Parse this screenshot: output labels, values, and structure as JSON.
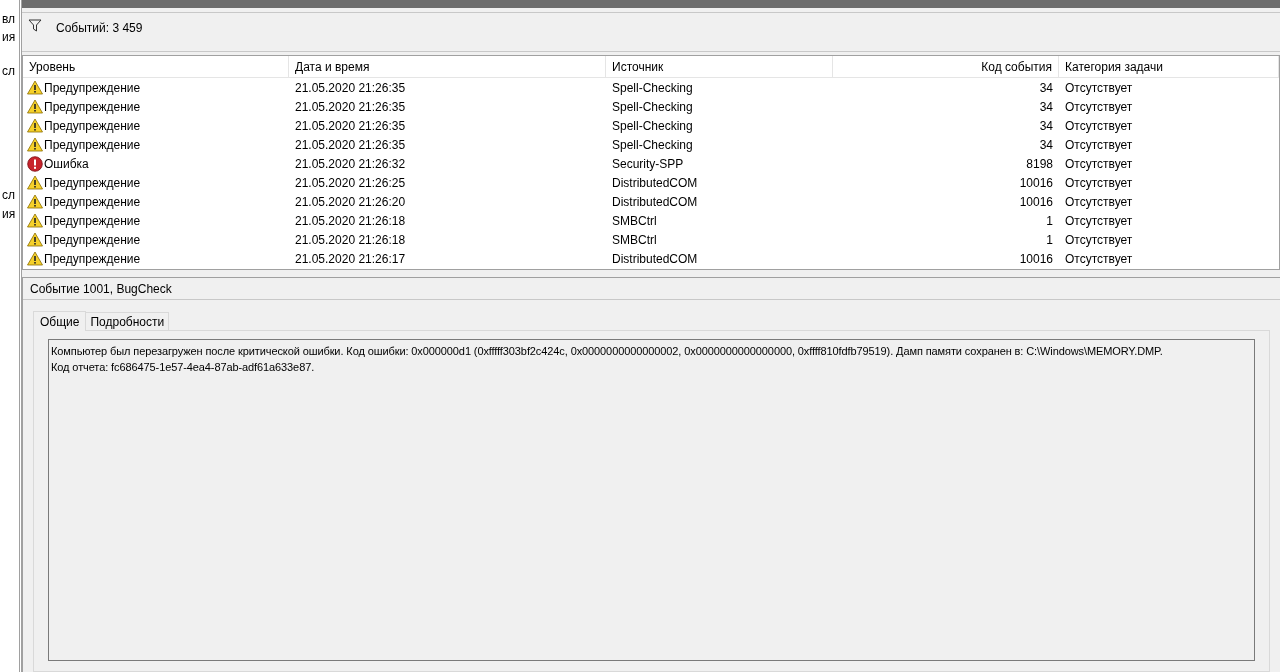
{
  "sidebar_fragments": [
    "вл",
    "ия",
    "сл",
    "сл",
    "ия"
  ],
  "toolbar": {
    "count_label": "Событий: 3 459"
  },
  "table": {
    "columns": [
      "Уровень",
      "Дата и время",
      "Источник",
      "Код события",
      "Категория задачи"
    ],
    "rows": [
      {
        "kind": "warning",
        "level": "Предупреждение",
        "date": "21.05.2020 21:26:35",
        "source": "Spell-Checking",
        "code": "34",
        "category": "Отсутствует"
      },
      {
        "kind": "warning",
        "level": "Предупреждение",
        "date": "21.05.2020 21:26:35",
        "source": "Spell-Checking",
        "code": "34",
        "category": "Отсутствует"
      },
      {
        "kind": "warning",
        "level": "Предупреждение",
        "date": "21.05.2020 21:26:35",
        "source": "Spell-Checking",
        "code": "34",
        "category": "Отсутствует"
      },
      {
        "kind": "warning",
        "level": "Предупреждение",
        "date": "21.05.2020 21:26:35",
        "source": "Spell-Checking",
        "code": "34",
        "category": "Отсутствует"
      },
      {
        "kind": "error",
        "level": "Ошибка",
        "date": "21.05.2020 21:26:32",
        "source": "Security-SPP",
        "code": "8198",
        "category": "Отсутствует"
      },
      {
        "kind": "warning",
        "level": "Предупреждение",
        "date": "21.05.2020 21:26:25",
        "source": "DistributedCOM",
        "code": "10016",
        "category": "Отсутствует"
      },
      {
        "kind": "warning",
        "level": "Предупреждение",
        "date": "21.05.2020 21:26:20",
        "source": "DistributedCOM",
        "code": "10016",
        "category": "Отсутствует"
      },
      {
        "kind": "warning",
        "level": "Предупреждение",
        "date": "21.05.2020 21:26:18",
        "source": "SMBCtrl",
        "code": "1",
        "category": "Отсутствует"
      },
      {
        "kind": "warning",
        "level": "Предупреждение",
        "date": "21.05.2020 21:26:18",
        "source": "SMBCtrl",
        "code": "1",
        "category": "Отсутствует"
      },
      {
        "kind": "warning",
        "level": "Предупреждение",
        "date": "21.05.2020 21:26:17",
        "source": "DistributedCOM",
        "code": "10016",
        "category": "Отсутствует"
      }
    ]
  },
  "details": {
    "title": "Событие 1001, BugCheck",
    "tabs": [
      {
        "label": "Общие",
        "selected": true
      },
      {
        "label": "Подробности",
        "selected": false
      }
    ],
    "text": [
      "Компьютер был перезагружен после критической ошибки.  Код ошибки: 0x000000d1 (0xfffff303bf2c424c, 0x0000000000000002, 0x0000000000000000, 0xffff810fdfb79519). Дамп памяти сохранен в: C:\\Windows\\MEMORY.DMP.",
      "Код отчета: fc686475-1e57-4ea4-87ab-adf61a633e87."
    ]
  }
}
